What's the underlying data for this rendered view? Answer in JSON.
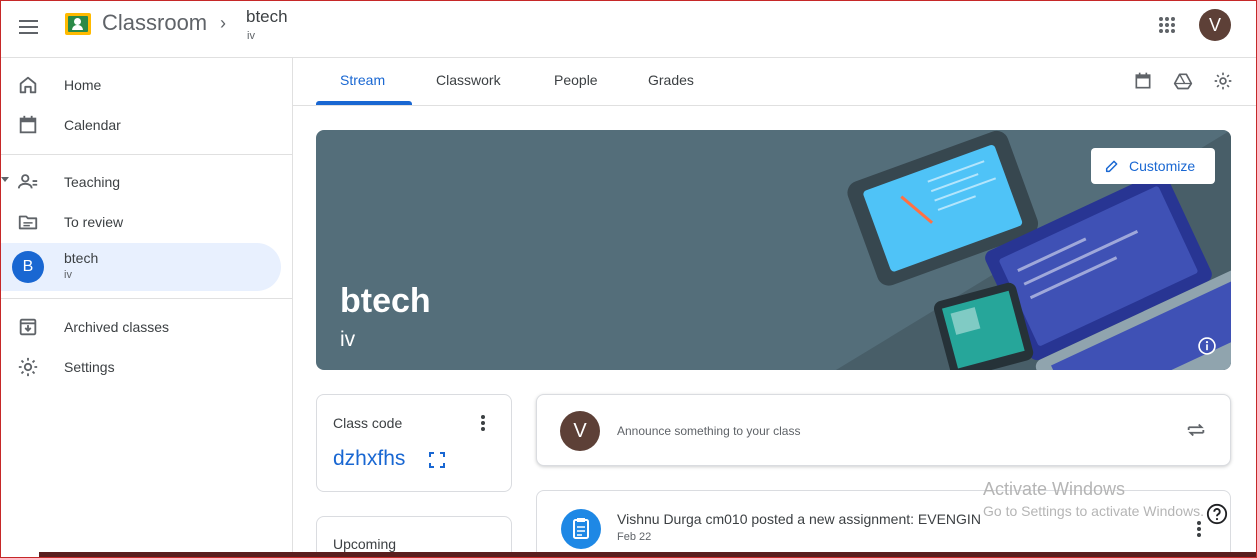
{
  "app": {
    "title": "Classroom",
    "breadcrumb_sep": "›",
    "class_title": "btech",
    "class_section": "iv",
    "user_initial": "V"
  },
  "sidebar": {
    "items": [
      {
        "label": "Home",
        "icon": "home-icon"
      },
      {
        "label": "Calendar",
        "icon": "calendar-icon"
      },
      {
        "label": "Teaching",
        "icon": "people-icon"
      },
      {
        "label": "To review",
        "icon": "folder-icon"
      },
      {
        "label": "btech",
        "sub": "iv",
        "badge": "B"
      },
      {
        "label": "Archived classes",
        "icon": "archive-icon"
      },
      {
        "label": "Settings",
        "icon": "gear-icon"
      }
    ]
  },
  "tabs": [
    {
      "label": "Stream",
      "active": true
    },
    {
      "label": "Classwork"
    },
    {
      "label": "People"
    },
    {
      "label": "Grades"
    }
  ],
  "banner": {
    "title": "btech",
    "subtitle": "iv",
    "customize_label": "Customize",
    "color": "#546e7a"
  },
  "class_code": {
    "label": "Class code",
    "code": "dzhxfhs"
  },
  "upcoming": {
    "label": "Upcoming"
  },
  "announce": {
    "placeholder": "Announce something to your class",
    "avatar": "V"
  },
  "post": {
    "title": "Vishnu Durga cm010 posted a new assignment: EVENGIN",
    "date": "Feb 22"
  },
  "watermark": {
    "line1": "Activate Windows",
    "line2": "Go to Settings to activate Windows."
  },
  "colors": {
    "accent": "#1967d2",
    "active_bg": "#e8f0fe",
    "avatar": "#5d4037"
  }
}
